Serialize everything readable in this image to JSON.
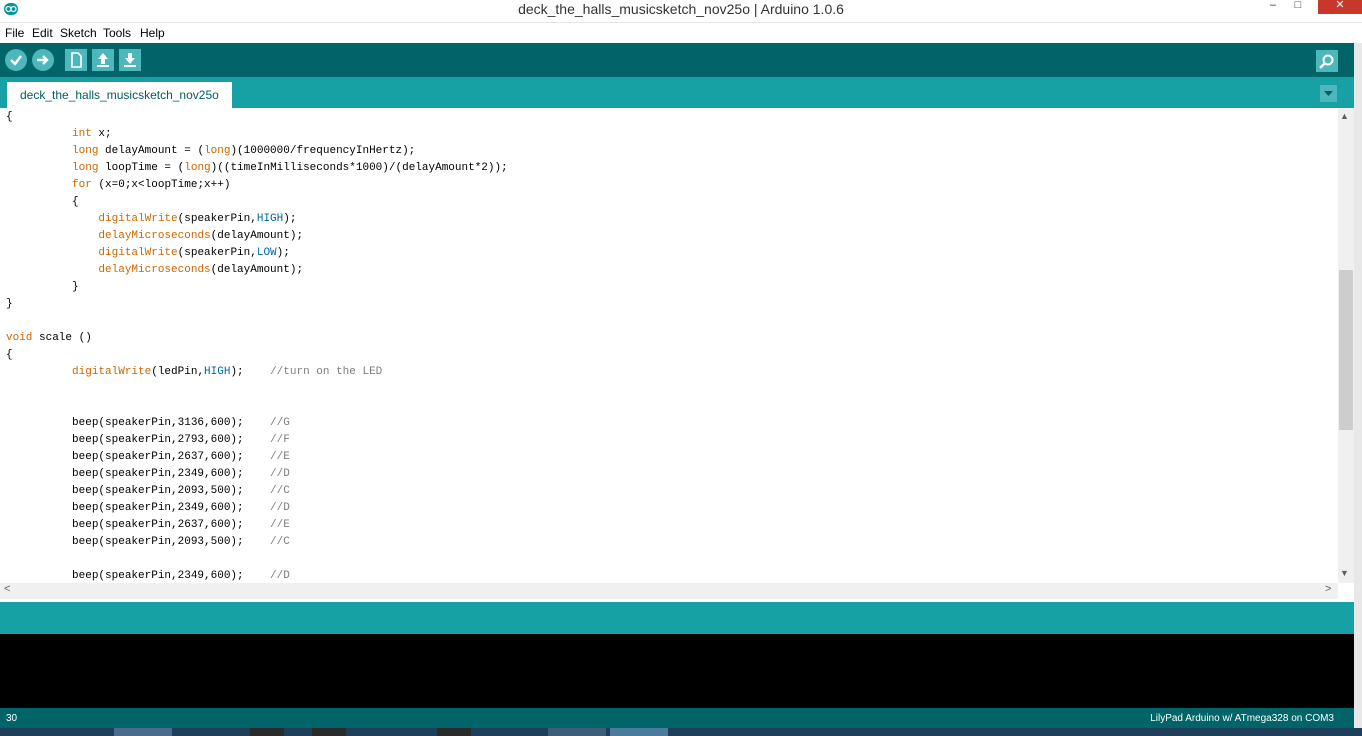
{
  "window": {
    "title": "deck_the_halls_musicsketch_nov25o | Arduino 1.0.6",
    "minimize_glyph": "–",
    "maximize_glyph": "□",
    "close_glyph": "✕"
  },
  "menu": {
    "items": [
      "File",
      "Edit",
      "Sketch",
      "Tools",
      "Help"
    ]
  },
  "toolbar": {
    "buttons": [
      "verify-icon",
      "upload-icon",
      "new-icon",
      "open-icon",
      "save-icon"
    ],
    "serial_monitor": "serial-monitor-icon"
  },
  "tabs": {
    "active": "deck_the_halls_musicsketch_nov25o",
    "menu_glyph": "▼"
  },
  "editor": {
    "lines": [
      [
        {
          "t": "{",
          "c": ""
        }
      ],
      [
        {
          "t": "          ",
          "c": ""
        },
        {
          "t": "int",
          "c": "kw"
        },
        {
          "t": " x;",
          "c": ""
        }
      ],
      [
        {
          "t": "          ",
          "c": ""
        },
        {
          "t": "long",
          "c": "kw"
        },
        {
          "t": " delayAmount = (",
          "c": ""
        },
        {
          "t": "long",
          "c": "kw"
        },
        {
          "t": ")(1000000/frequencyInHertz);",
          "c": ""
        }
      ],
      [
        {
          "t": "          ",
          "c": ""
        },
        {
          "t": "long",
          "c": "kw"
        },
        {
          "t": " loopTime = (",
          "c": ""
        },
        {
          "t": "long",
          "c": "kw"
        },
        {
          "t": ")((timeInMilliseconds*1000)/(delayAmount*2));",
          "c": ""
        }
      ],
      [
        {
          "t": "          ",
          "c": ""
        },
        {
          "t": "for",
          "c": "kw"
        },
        {
          "t": " (x=0;x<loopTime;x++)",
          "c": ""
        }
      ],
      [
        {
          "t": "          {",
          "c": ""
        }
      ],
      [
        {
          "t": "              ",
          "c": ""
        },
        {
          "t": "digitalWrite",
          "c": "kw"
        },
        {
          "t": "(speakerPin,",
          "c": ""
        },
        {
          "t": "HIGH",
          "c": "cst"
        },
        {
          "t": ");",
          "c": ""
        }
      ],
      [
        {
          "t": "              ",
          "c": ""
        },
        {
          "t": "delayMicroseconds",
          "c": "kw"
        },
        {
          "t": "(delayAmount);",
          "c": ""
        }
      ],
      [
        {
          "t": "              ",
          "c": ""
        },
        {
          "t": "digitalWrite",
          "c": "kw"
        },
        {
          "t": "(speakerPin,",
          "c": ""
        },
        {
          "t": "LOW",
          "c": "cst"
        },
        {
          "t": ");",
          "c": ""
        }
      ],
      [
        {
          "t": "              ",
          "c": ""
        },
        {
          "t": "delayMicroseconds",
          "c": "kw"
        },
        {
          "t": "(delayAmount);",
          "c": ""
        }
      ],
      [
        {
          "t": "          }",
          "c": ""
        }
      ],
      [
        {
          "t": "}",
          "c": ""
        }
      ],
      [
        {
          "t": "",
          "c": ""
        }
      ],
      [
        {
          "t": "void",
          "c": "kw"
        },
        {
          "t": " scale ()",
          "c": ""
        }
      ],
      [
        {
          "t": "{",
          "c": ""
        }
      ],
      [
        {
          "t": "          ",
          "c": ""
        },
        {
          "t": "digitalWrite",
          "c": "kw"
        },
        {
          "t": "(ledPin,",
          "c": ""
        },
        {
          "t": "HIGH",
          "c": "cst"
        },
        {
          "t": ");    ",
          "c": ""
        },
        {
          "t": "//turn on the LED",
          "c": "cm"
        }
      ],
      [
        {
          "t": "",
          "c": ""
        }
      ],
      [
        {
          "t": "",
          "c": ""
        }
      ],
      [
        {
          "t": "          beep(speakerPin,3136,600);    ",
          "c": ""
        },
        {
          "t": "//G",
          "c": "cm"
        }
      ],
      [
        {
          "t": "          beep(speakerPin,2793,600);    ",
          "c": ""
        },
        {
          "t": "//F",
          "c": "cm"
        }
      ],
      [
        {
          "t": "          beep(speakerPin,2637,600);    ",
          "c": ""
        },
        {
          "t": "//E",
          "c": "cm"
        }
      ],
      [
        {
          "t": "          beep(speakerPin,2349,600);    ",
          "c": ""
        },
        {
          "t": "//D",
          "c": "cm"
        }
      ],
      [
        {
          "t": "          beep(speakerPin,2093,500);    ",
          "c": ""
        },
        {
          "t": "//C",
          "c": "cm"
        }
      ],
      [
        {
          "t": "          beep(speakerPin,2349,600);    ",
          "c": ""
        },
        {
          "t": "//D",
          "c": "cm"
        }
      ],
      [
        {
          "t": "          beep(speakerPin,2637,600);    ",
          "c": ""
        },
        {
          "t": "//E",
          "c": "cm"
        }
      ],
      [
        {
          "t": "          beep(speakerPin,2093,500);    ",
          "c": ""
        },
        {
          "t": "//C",
          "c": "cm"
        }
      ],
      [
        {
          "t": "",
          "c": ""
        }
      ],
      [
        {
          "t": "          beep(speakerPin,2349,600);    ",
          "c": ""
        },
        {
          "t": "//D",
          "c": "cm"
        }
      ]
    ]
  },
  "scroll": {
    "up": "▲",
    "down": "▼",
    "left": "<",
    "right": ">"
  },
  "footer": {
    "line_number": "30",
    "board": "LilyPad Arduino w/ ATmega328 on COM3"
  },
  "colors": {
    "toolbar": "#006468",
    "tabstrip": "#17a1a5",
    "keyword": "#cc6600",
    "constant": "#006699",
    "comment": "#7e7e7e"
  }
}
